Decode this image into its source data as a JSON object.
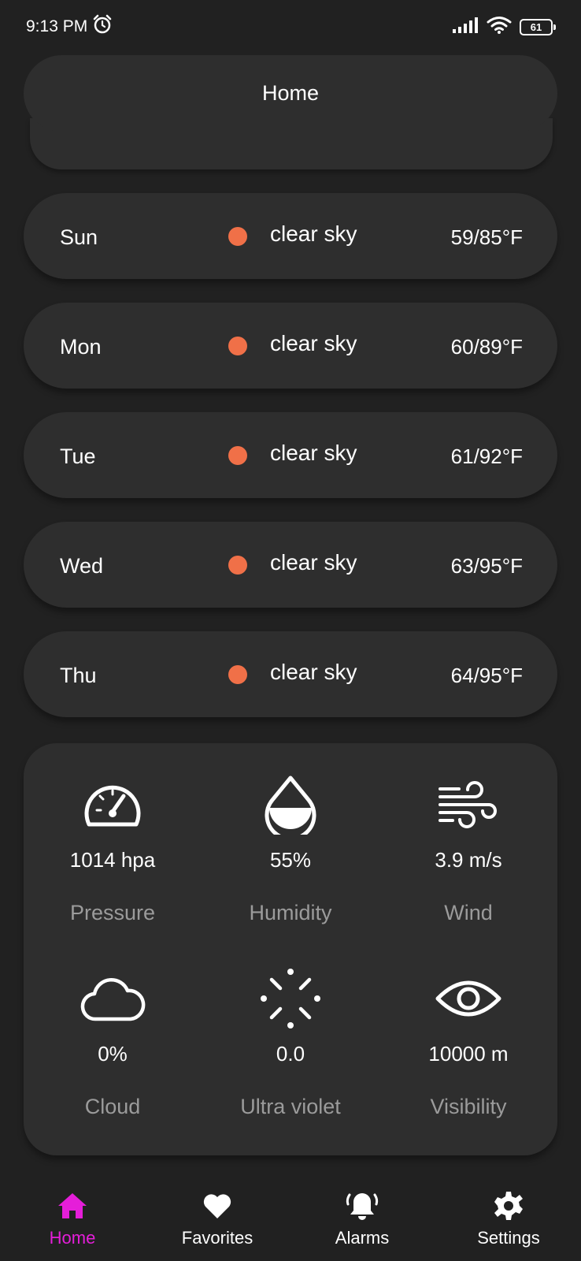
{
  "status_bar": {
    "time": "9:13 PM",
    "battery": "61"
  },
  "top_bar": {
    "title": "Home"
  },
  "forecast": [
    {
      "day": "Sun",
      "description": "clear sky",
      "temp": "59/85°F"
    },
    {
      "day": "Mon",
      "description": "clear sky",
      "temp": "60/89°F"
    },
    {
      "day": "Tue",
      "description": "clear sky",
      "temp": "61/92°F"
    },
    {
      "day": "Wed",
      "description": "clear sky",
      "temp": "63/95°F"
    },
    {
      "day": "Thu",
      "description": "clear sky",
      "temp": "64/95°F"
    }
  ],
  "details": {
    "pressure": {
      "value": "1014 hpa",
      "label": "Pressure",
      "icon": "speedometer-icon"
    },
    "humidity": {
      "value": "55%",
      "label": "Humidity",
      "icon": "water-drop-icon"
    },
    "wind": {
      "value": "3.9 m/s",
      "label": "Wind",
      "icon": "wind-icon"
    },
    "cloud": {
      "value": "0%",
      "label": "Cloud",
      "icon": "cloud-icon"
    },
    "uv": {
      "value": "0.0",
      "label": "Ultra violet",
      "icon": "uv-icon"
    },
    "visibility": {
      "value": "10000 m",
      "label": "Visibility",
      "icon": "eye-icon"
    }
  },
  "nav": {
    "items": [
      {
        "label": "Home",
        "icon": "home-icon",
        "active": true
      },
      {
        "label": "Favorites",
        "icon": "heart-icon",
        "active": false
      },
      {
        "label": "Alarms",
        "icon": "bell-icon",
        "active": false
      },
      {
        "label": "Settings",
        "icon": "gear-icon",
        "active": false
      }
    ]
  },
  "colors": {
    "background": "#212121",
    "card": "#2e2e2e",
    "accent": "#e51ed9",
    "weather_dot": "#f07048",
    "label_gray": "#9b9b9b"
  }
}
